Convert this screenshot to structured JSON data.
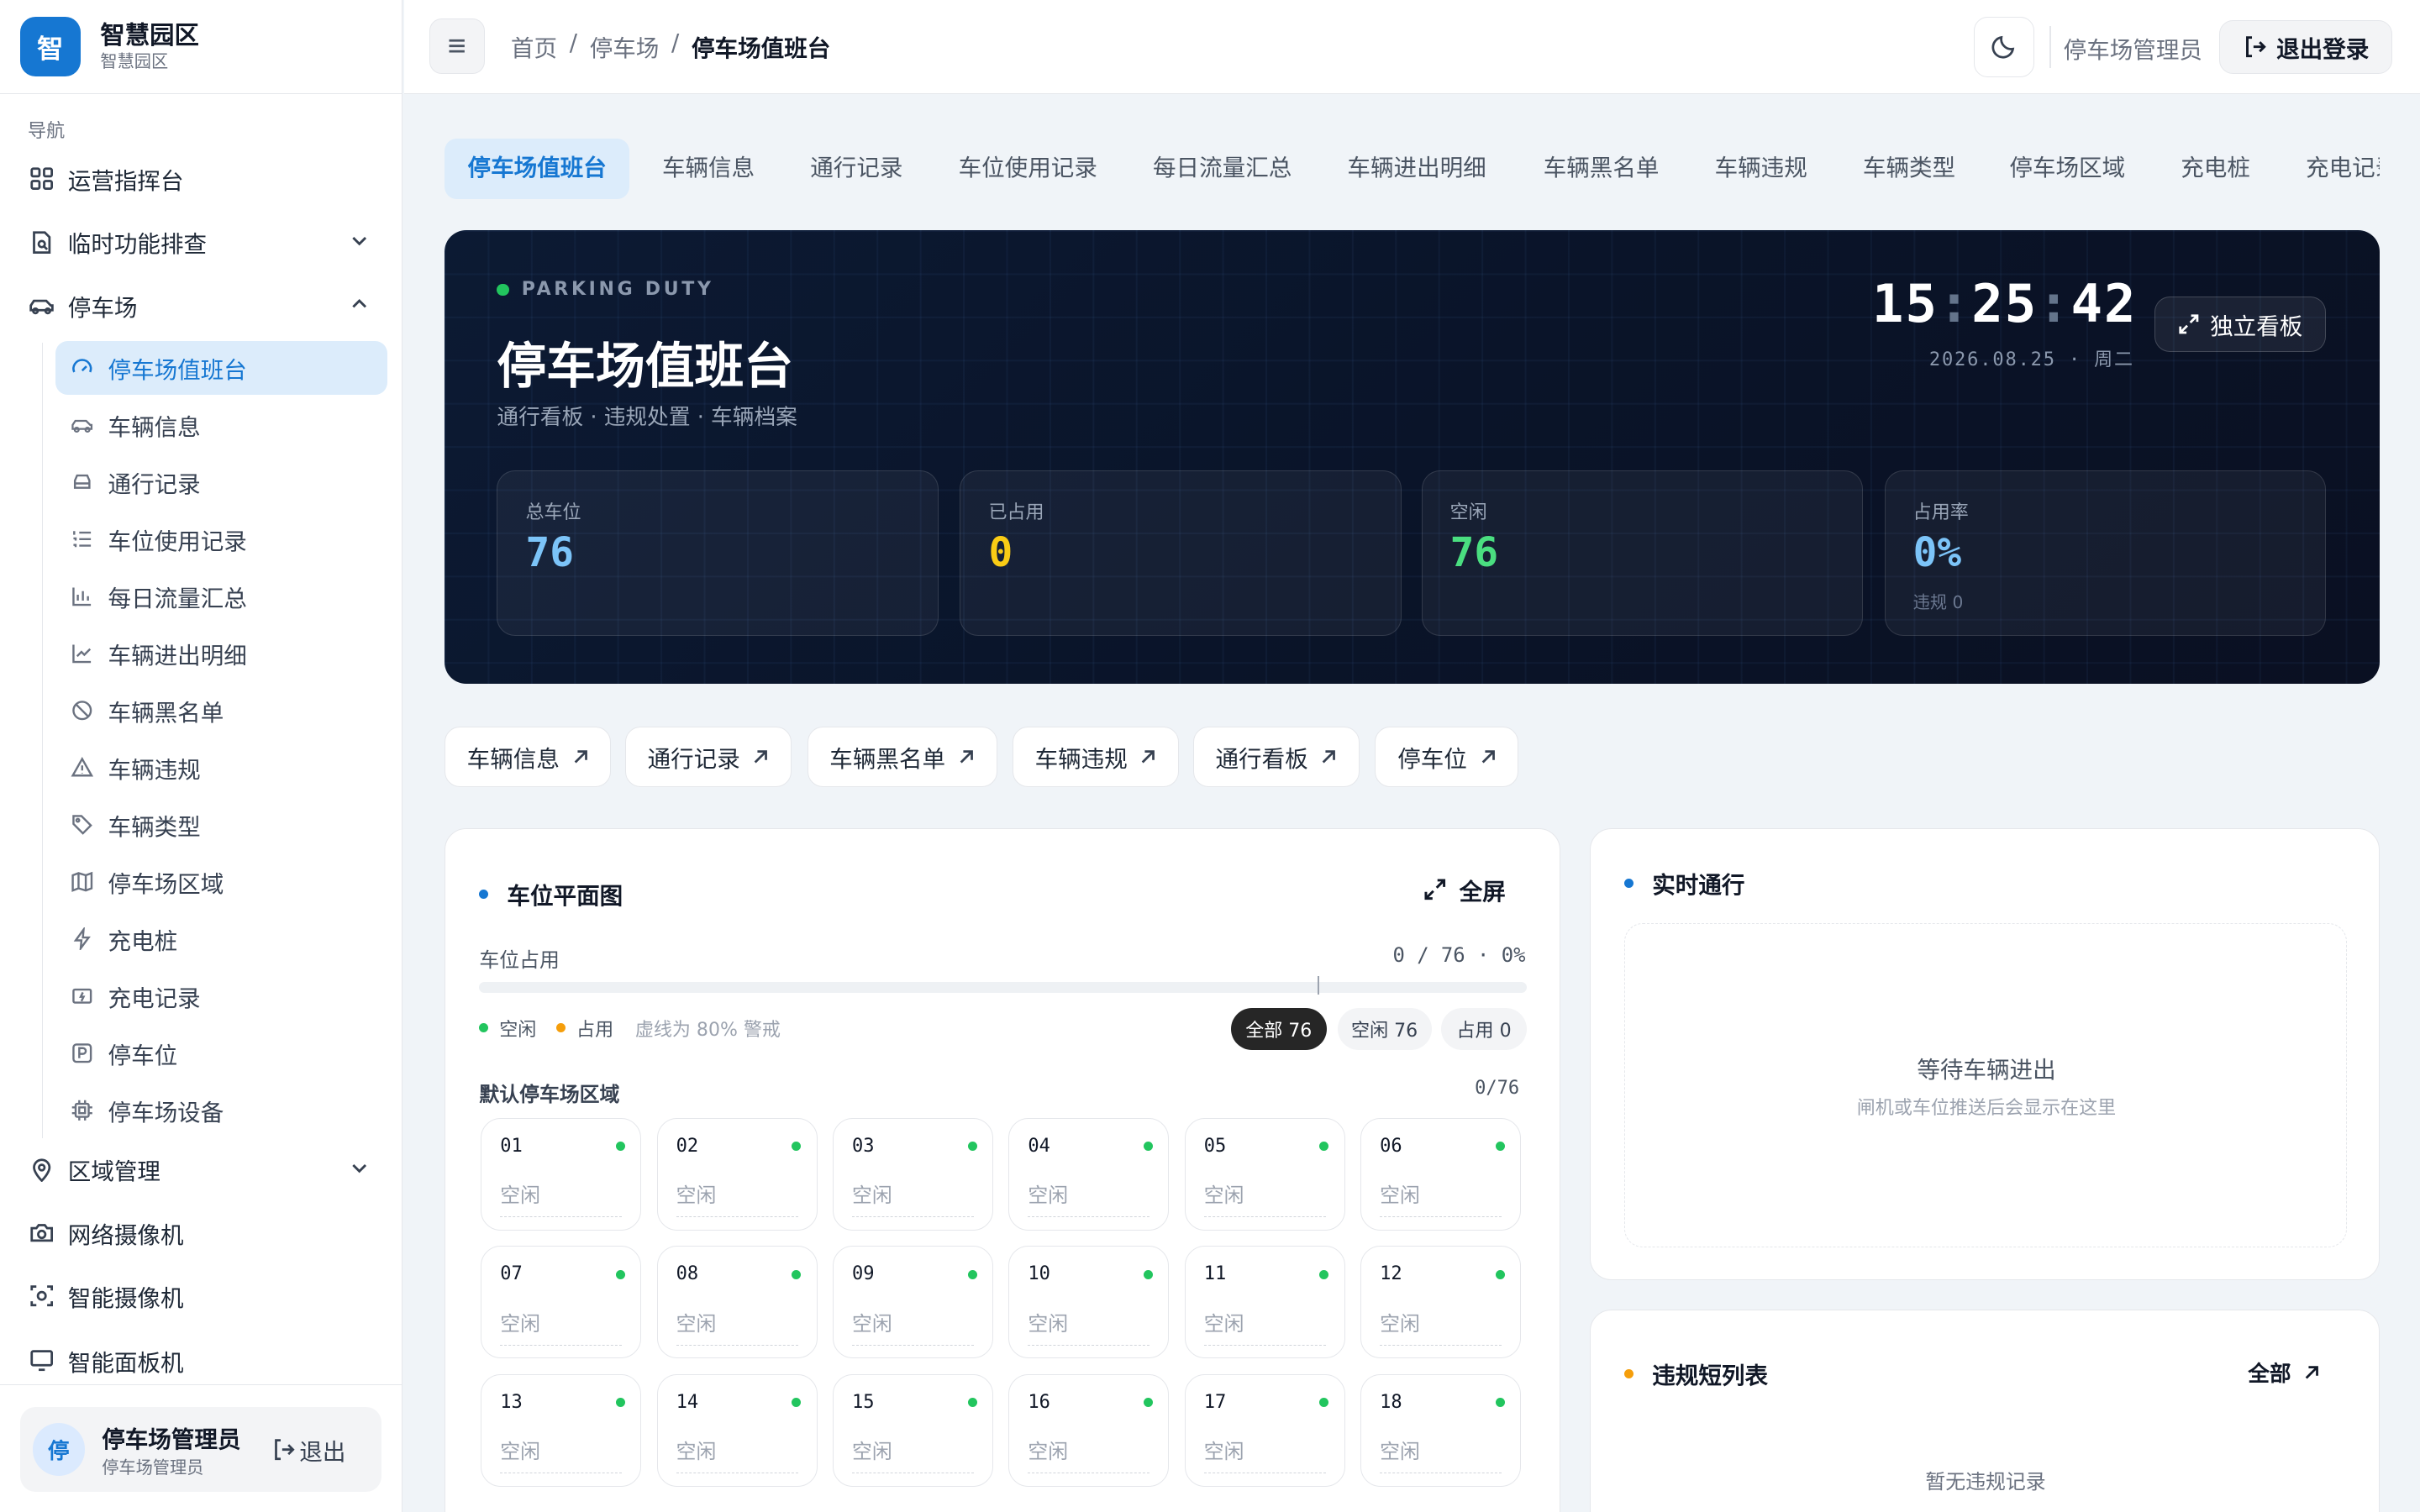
{
  "brand": {
    "logo": "智",
    "title": "智慧园区",
    "subtitle": "智慧园区"
  },
  "nav": {
    "group_label": "导航",
    "items": [
      {
        "label": "运营指挥台",
        "icon": "dashboard-grid-icon"
      },
      {
        "label": "临时功能排查",
        "icon": "file-search-icon"
      },
      {
        "label": "停车场",
        "icon": "car-icon"
      },
      {
        "label": "区域管理",
        "icon": "map-pin-icon"
      },
      {
        "label": "网络摄像机",
        "icon": "camera-icon"
      },
      {
        "label": "智能摄像机",
        "icon": "scan-camera-icon"
      },
      {
        "label": "智能面板机",
        "icon": "monitor-icon"
      }
    ],
    "parking_sub": [
      {
        "label": "停车场值班台",
        "icon": "gauge-icon"
      },
      {
        "label": "车辆信息",
        "icon": "car-icon"
      },
      {
        "label": "通行记录",
        "icon": "car-front-icon"
      },
      {
        "label": "车位使用记录",
        "icon": "list-ordered-icon"
      },
      {
        "label": "每日流量汇总",
        "icon": "bar-chart-icon"
      },
      {
        "label": "车辆进出明细",
        "icon": "line-chart-icon"
      },
      {
        "label": "车辆黑名单",
        "icon": "ban-icon"
      },
      {
        "label": "车辆违规",
        "icon": "warning-icon"
      },
      {
        "label": "车辆类型",
        "icon": "tag-icon"
      },
      {
        "label": "停车场区域",
        "icon": "map-icon"
      },
      {
        "label": "充电桩",
        "icon": "bolt-icon"
      },
      {
        "label": "充电记录",
        "icon": "charge-record-icon"
      },
      {
        "label": "停车位",
        "icon": "parking-icon"
      },
      {
        "label": "停车场设备",
        "icon": "cpu-icon"
      }
    ]
  },
  "user": {
    "avatar": "停",
    "name": "停车场管理员",
    "role": "停车场管理员",
    "logout": "退出"
  },
  "header": {
    "breadcrumbs": [
      "首页",
      "停车场",
      "停车场值班台"
    ],
    "separator": "/",
    "user": "停车场管理员",
    "logout": "退出登录"
  },
  "tabs": [
    "停车场值班台",
    "车辆信息",
    "通行记录",
    "车位使用记录",
    "每日流量汇总",
    "车辆进出明细",
    "车辆黑名单",
    "车辆违规",
    "车辆类型",
    "停车场区域",
    "充电桩",
    "充电记录"
  ],
  "hero": {
    "tag": "PARKING DUTY",
    "title": "停车场值班台",
    "subtitle": "通行看板 · 违规处置 · 车辆档案",
    "clock": {
      "h": "15",
      "m": "25",
      "s": "42",
      "sep": ":"
    },
    "date": "2026.08.25 · 周二",
    "standalone": "独立看板",
    "stats": [
      {
        "label": "总车位",
        "value": "76",
        "color": "#7cc4f8"
      },
      {
        "label": "已占用",
        "value": "0",
        "color": "#facc15"
      },
      {
        "label": "空闲",
        "value": "76",
        "color": "#4ade80"
      },
      {
        "label": "占用率",
        "value": "0%",
        "color": "#7cc4f8",
        "note": "违规 0"
      }
    ]
  },
  "quick_links": [
    "车辆信息",
    "通行记录",
    "车辆黑名单",
    "车辆违规",
    "通行看板",
    "停车位"
  ],
  "map_panel": {
    "title": "车位平面图",
    "fullscreen": "全屏",
    "occupancy_label": "车位占用",
    "occupancy_value": "0 / 76 · 0%",
    "occupancy_fraction": 0,
    "legend": {
      "free": "空闲",
      "occupied": "占用",
      "note": "虚线为 80% 警戒"
    },
    "filters": [
      "全部 76",
      "空闲 76",
      "占用 0"
    ],
    "zone": {
      "name": "默认停车场区域",
      "count": "0/76"
    },
    "slots": [
      {
        "no": "01",
        "status": "空闲"
      },
      {
        "no": "02",
        "status": "空闲"
      },
      {
        "no": "03",
        "status": "空闲"
      },
      {
        "no": "04",
        "status": "空闲"
      },
      {
        "no": "05",
        "status": "空闲"
      },
      {
        "no": "06",
        "status": "空闲"
      },
      {
        "no": "07",
        "status": "空闲"
      },
      {
        "no": "08",
        "status": "空闲"
      },
      {
        "no": "09",
        "status": "空闲"
      },
      {
        "no": "10",
        "status": "空闲"
      },
      {
        "no": "11",
        "status": "空闲"
      },
      {
        "no": "12",
        "status": "空闲"
      },
      {
        "no": "13",
        "status": "空闲"
      },
      {
        "no": "14",
        "status": "空闲"
      },
      {
        "no": "15",
        "status": "空闲"
      },
      {
        "no": "16",
        "status": "空闲"
      },
      {
        "no": "17",
        "status": "空闲"
      },
      {
        "no": "18",
        "status": "空闲"
      }
    ]
  },
  "realtime": {
    "title": "实时通行",
    "empty_title": "等待车辆进出",
    "empty_sub": "闸机或车位推送后会显示在这里"
  },
  "violations": {
    "title": "违规短列表",
    "all": "全部",
    "empty": "暂无违规记录"
  },
  "colors": {
    "accent": "#1677d2",
    "free": "#22c55e",
    "occupied": "#f59e0b"
  }
}
